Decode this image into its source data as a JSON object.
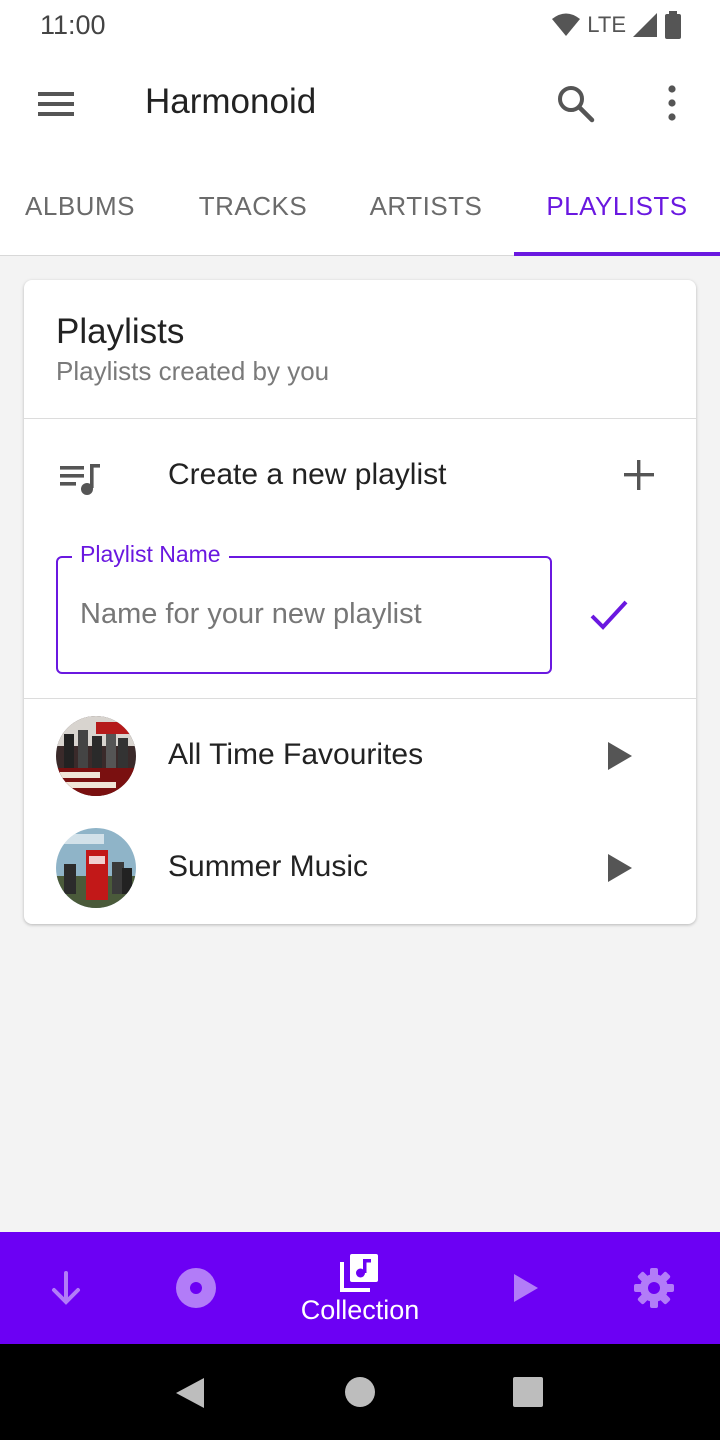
{
  "status_bar": {
    "time": "11:00",
    "network": "LTE"
  },
  "app_bar": {
    "title": "Harmonoid"
  },
  "tabs": [
    {
      "label": "ALBUMS",
      "active": false
    },
    {
      "label": "TRACKS",
      "active": false
    },
    {
      "label": "ARTISTS",
      "active": false
    },
    {
      "label": "PLAYLISTS",
      "active": true
    }
  ],
  "card": {
    "title": "Playlists",
    "subtitle": "Playlists created by you",
    "create_label": "Create a new playlist",
    "name_field": {
      "label": "Playlist Name",
      "placeholder": "Name for your new playlist",
      "value": ""
    },
    "playlists": [
      {
        "name": "All Time Favourites"
      },
      {
        "name": "Summer Music"
      }
    ]
  },
  "bottom_nav": {
    "items": [
      {
        "icon": "download-icon"
      },
      {
        "icon": "album-disc-icon"
      },
      {
        "icon": "library-music-icon",
        "label": "Collection",
        "active": true
      },
      {
        "icon": "play-icon"
      },
      {
        "icon": "settings-icon"
      }
    ]
  },
  "colors": {
    "accent": "#6a18e0",
    "bottom_nav_bg": "#6c00f4",
    "background": "#f3f3f3"
  }
}
